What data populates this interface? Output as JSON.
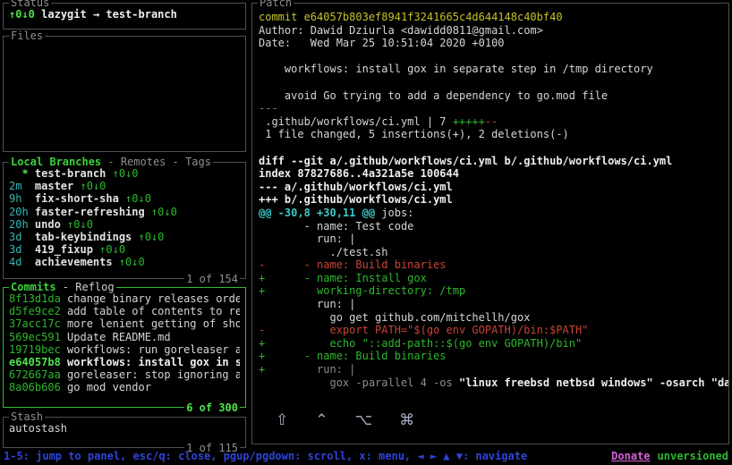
{
  "colors": {
    "green": "#2db82d",
    "bright_green": "#4fe34f",
    "cyan": "#36b6b6",
    "yellow": "#c3c32a",
    "red": "#c94434",
    "blue": "#2e45d8",
    "magenta": "#d75fd7",
    "border_grey": "#4f4f4f",
    "border_focused": "#2ebc2e"
  },
  "status_panel": {
    "title": "Status",
    "ahead_behind": "↑0↓0",
    "repo_state": "lazygit → test-branch"
  },
  "files_panel": {
    "title": "Files"
  },
  "branches_panel": {
    "title": "Local Branches",
    "tabs_suffix": " - Remotes - Tags",
    "position": "1 of 154",
    "items": [
      {
        "recency": "  *",
        "rc": "g",
        "name": "test-branch",
        "updown": "↑0↓0"
      },
      {
        "recency": "2m",
        "rc": "c",
        "name": "master",
        "updown": "↑0↓0"
      },
      {
        "recency": "9h",
        "rc": "c",
        "name": "fix-short-sha",
        "updown": "↑0↓0"
      },
      {
        "recency": "20h",
        "rc": "c",
        "name": "faster-refreshing",
        "updown": "↑0↓0"
      },
      {
        "recency": "20h",
        "rc": "c",
        "name": "undo",
        "updown": "↑0↓0"
      },
      {
        "recency": "3d",
        "rc": "c",
        "name": "tab-keybindings",
        "updown": "↑0↓0"
      },
      {
        "recency": "3d",
        "rc": "c",
        "name": "419_fixup",
        "updown": "↑0↓0"
      },
      {
        "recency": "4d",
        "rc": "c",
        "name": "achievements",
        "updown": "↑0↓0"
      }
    ]
  },
  "commits_panel": {
    "title": "Commits",
    "tabs_suffix": " - Reflog",
    "position": "6 of 300",
    "items": [
      {
        "sha": "8f13d1da",
        "message": "change binary releases order",
        "selected": false
      },
      {
        "sha": "d5fe9ce2",
        "message": "add table of contents to rea",
        "selected": false
      },
      {
        "sha": "37acc17c",
        "message": "more lenient getting of shor",
        "selected": false
      },
      {
        "sha": "569ec591",
        "message": "Update README.md",
        "selected": false
      },
      {
        "sha": "19719bec",
        "message": "workflows: run goreleaser as",
        "selected": false
      },
      {
        "sha": "e64057b8",
        "message": "workflows: install gox in se",
        "selected": true
      },
      {
        "sha": "672667aa",
        "message": "goreleaser: stop ignoring ar",
        "selected": false
      },
      {
        "sha": "8a06b606",
        "message": "go mod vendor",
        "selected": false
      }
    ]
  },
  "stash_panel": {
    "title": "Stash",
    "position": "1 of 115",
    "items": [
      "autostash"
    ]
  },
  "patch_panel": {
    "title": "Patch",
    "modifier_keys": [
      "⇧",
      "⌃",
      "⌥",
      "⌘"
    ],
    "lines": [
      {
        "s": [
          {
            "t": "commit e64057b803ef8941f3241665c4d644148c40bf40",
            "c": "y"
          }
        ]
      },
      {
        "s": [
          {
            "t": "Author: Dawid Dziurla <dawidd0811@gmail.com>",
            "c": "w"
          }
        ]
      },
      {
        "s": [
          {
            "t": "Date:   Wed Mar 25 10:51:04 2020 +0100",
            "c": "w"
          }
        ]
      },
      {
        "s": []
      },
      {
        "s": [
          {
            "t": "    workflows: install gox in separate step in /tmp directory",
            "c": "w"
          }
        ]
      },
      {
        "s": []
      },
      {
        "s": [
          {
            "t": "    avoid Go trying to add a dependency to go.mod file",
            "c": "w"
          }
        ]
      },
      {
        "s": [
          {
            "t": "---",
            "c": "d"
          }
        ]
      },
      {
        "s": [
          {
            "t": " .github/workflows/ci.yml | 7 ",
            "c": "w"
          },
          {
            "t": "+++++",
            "c": "g"
          },
          {
            "t": "--",
            "c": "r"
          }
        ]
      },
      {
        "s": [
          {
            "t": " 1 file changed, 5 insertions(+), 2 deletions(-)",
            "c": "w"
          }
        ]
      },
      {
        "s": []
      },
      {
        "s": [
          {
            "t": "diff --git a/.github/workflows/ci.yml b/.github/workflows/ci.yml",
            "c": "b"
          }
        ]
      },
      {
        "s": [
          {
            "t": "index 87827686..4a321a5e 100644",
            "c": "b"
          }
        ]
      },
      {
        "s": [
          {
            "t": "--- a/.github/workflows/ci.yml",
            "c": "b"
          }
        ]
      },
      {
        "s": [
          {
            "t": "+++ b/.github/workflows/ci.yml",
            "c": "b"
          }
        ]
      },
      {
        "s": [
          {
            "t": "@@ -30,8 +30,11 @@",
            "c": "c"
          },
          {
            "t": " jobs:",
            "c": "w"
          }
        ]
      },
      {
        "s": [
          {
            "t": "       - name: Test code",
            "c": "w"
          }
        ]
      },
      {
        "s": [
          {
            "t": "         run: |",
            "c": "w"
          }
        ]
      },
      {
        "s": [
          {
            "t": "           ./test.sh",
            "c": "w"
          }
        ]
      },
      {
        "s": [
          {
            "t": "-      - name: Build binaries",
            "c": "r"
          }
        ]
      },
      {
        "s": [
          {
            "t": "+      - name: Install gox",
            "c": "g"
          }
        ]
      },
      {
        "s": [
          {
            "t": "+        working-directory: /tmp",
            "c": "g"
          }
        ]
      },
      {
        "s": [
          {
            "t": "         run: |",
            "c": "w"
          }
        ]
      },
      {
        "s": [
          {
            "t": "           go get github.com/mitchellh/gox",
            "c": "w"
          }
        ]
      },
      {
        "s": [
          {
            "t": "-          export PATH=\"$(go env GOPATH)/bin:$PATH\"",
            "c": "r"
          }
        ]
      },
      {
        "s": [
          {
            "t": "+          echo \"::add-path::$(go env GOPATH)/bin\"",
            "c": "g"
          }
        ]
      },
      {
        "s": [
          {
            "t": "+      - name: Build binaries",
            "c": "g"
          }
        ]
      },
      {
        "s": [
          {
            "t": "+",
            "c": "g"
          },
          {
            "t": "        run: |",
            "c": "f"
          }
        ]
      },
      {
        "s": [
          {
            "t": "           gox -parallel 4 -os",
            "c": "f"
          },
          {
            "t": " \"linux freebsd netbsd windows\" -osarch \"darw",
            "c": "b"
          }
        ]
      }
    ]
  },
  "status_bar": {
    "keybindings": "1-5: jump to panel, esc/q: close, pgup/pgdown: scroll, x: menu, ◄ ► ▲ ▼: navigate",
    "donate": "Donate",
    "version": "unversioned"
  }
}
